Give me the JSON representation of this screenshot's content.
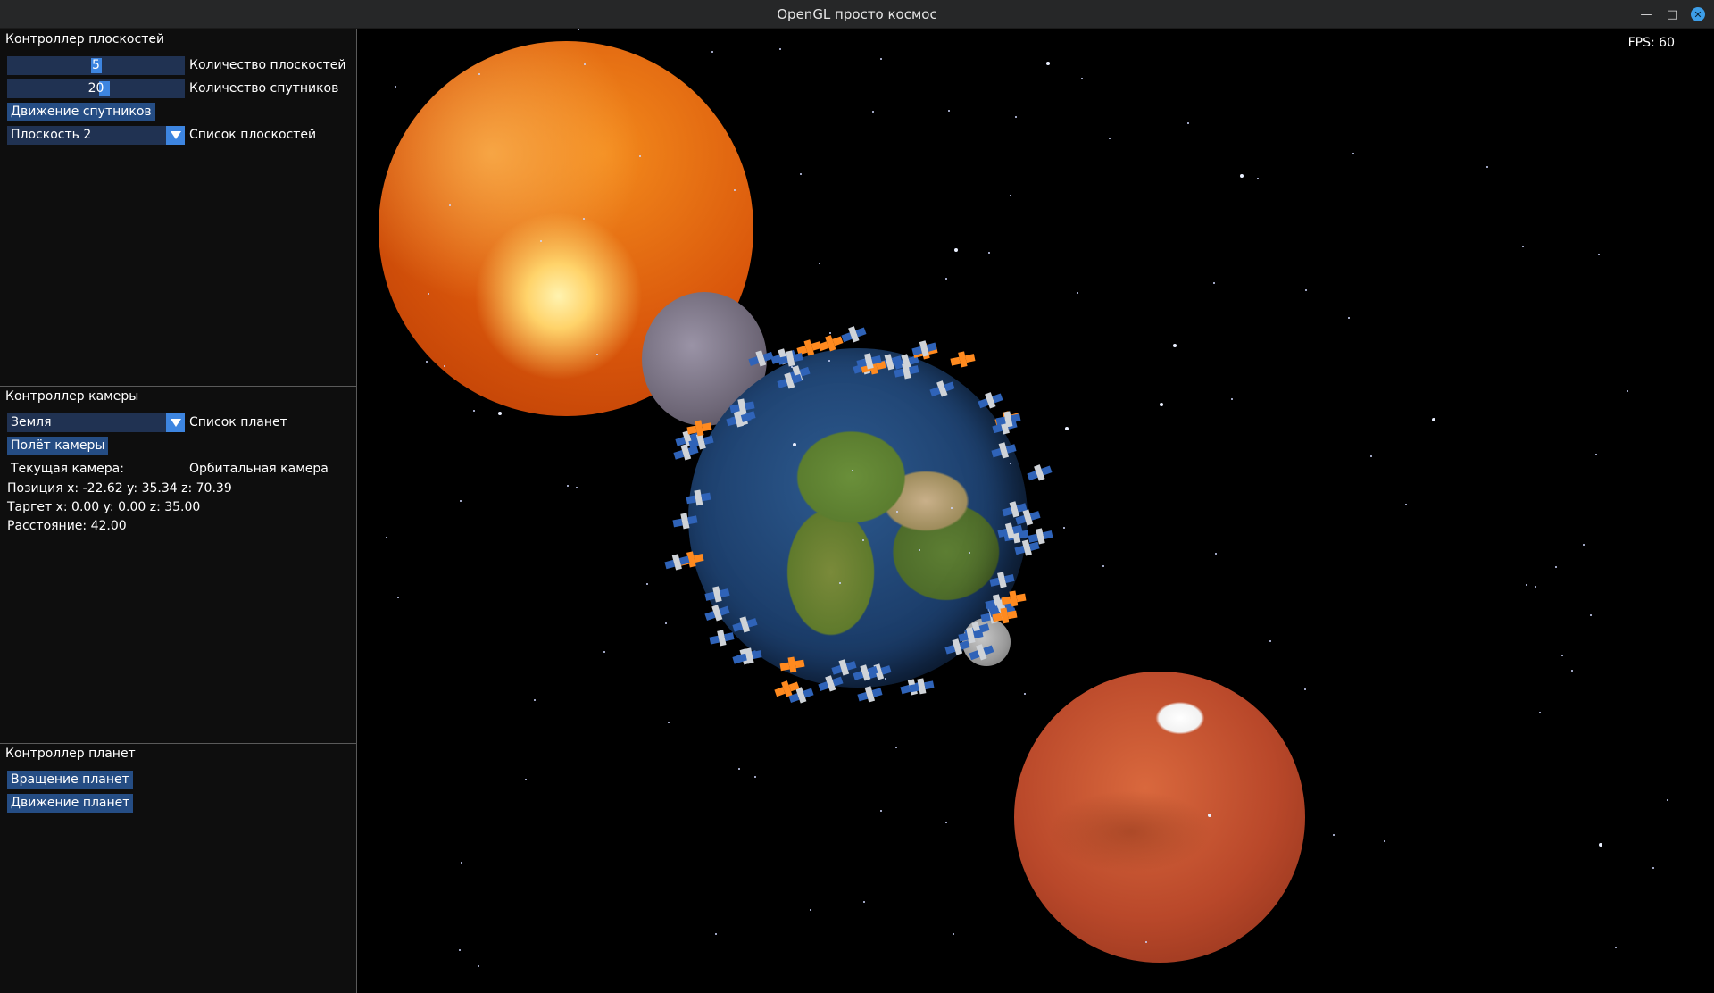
{
  "window": {
    "title": "OpenGL просто космос",
    "minimize_icon": "—",
    "maximize_icon": "□",
    "close_icon": "✕"
  },
  "planes_panel": {
    "header": "Контроллер плоскостей",
    "plane_count_value": "5",
    "plane_count_fraction": 0.5,
    "plane_count_label": "Количество плоскостей",
    "satellite_count_value": "20",
    "satellite_count_fraction": 0.55,
    "satellite_count_label": "Количество спутников",
    "satellite_motion_button": "Движение спутников",
    "plane_select_value": "Плоскость 2",
    "plane_list_label": "Список плоскостей"
  },
  "camera_panel": {
    "header": "Контроллер камеры",
    "planet_select_value": "Земля",
    "planet_list_label": "Список планет",
    "camera_flight_button": "Полёт камеры",
    "current_camera_label": "Текущая камера:",
    "current_camera_value": "Орбитальная камера",
    "position_text": "Позиция x: -22.62 y: 35.34 z: 70.39",
    "target_text": "Таргет x: 0.00 y: 0.00 z: 35.00",
    "distance_text": "Расстояние: 42.00"
  },
  "planets_panel": {
    "header": "Контроллер планет",
    "rotation_button": "Вращение планет",
    "motion_button": "Движение планет"
  },
  "scene": {
    "fps_text": "FPS: 60"
  },
  "colors": {
    "button": "#254d84",
    "slider_bg": "#203252",
    "accent": "#3d85e0",
    "panel_bg": "#0e0e0e",
    "titlebar_bg": "#262728"
  }
}
